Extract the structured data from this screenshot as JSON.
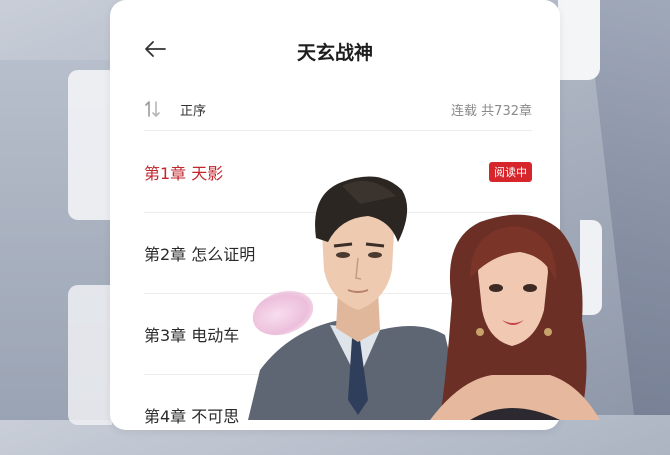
{
  "header": {
    "title": "天玄战神"
  },
  "sort": {
    "label": "正序",
    "status": "连载 共732章"
  },
  "chapters": [
    {
      "title": "第1章 天影",
      "badge": "阅读中"
    },
    {
      "title": "第2章 怎么证明"
    },
    {
      "title": "第3章 电动车"
    },
    {
      "title": "第4章 不可思"
    }
  ],
  "colors": {
    "accent": "#c1272d",
    "badge_bg": "#d6262c"
  },
  "icons": {
    "back": "arrow-left-icon",
    "sort": "sort-order-icon"
  }
}
